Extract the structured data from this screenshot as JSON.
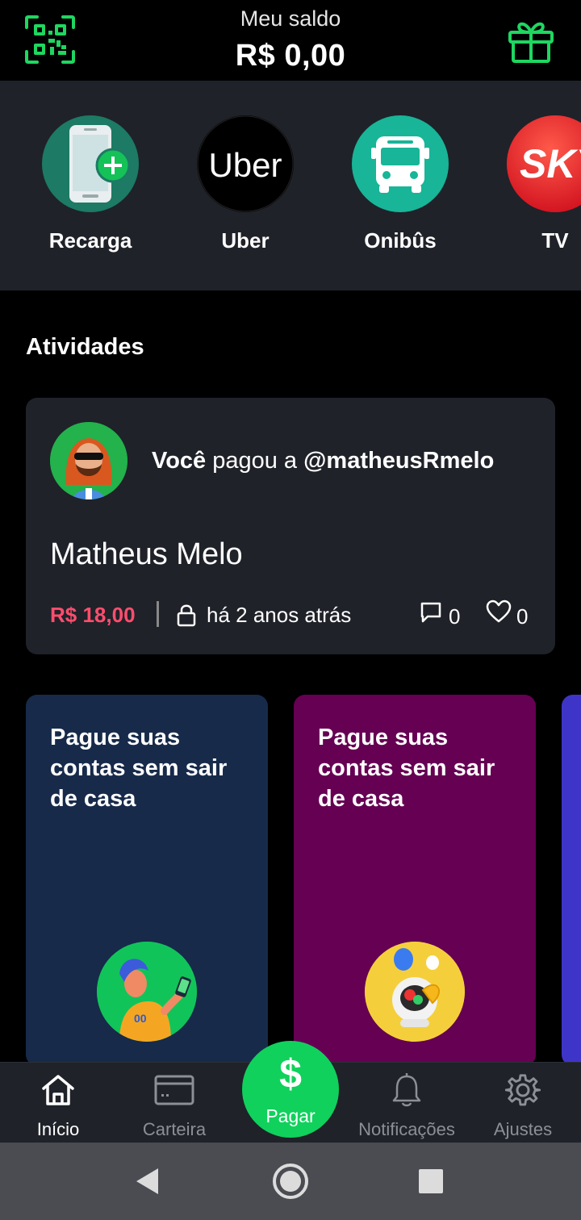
{
  "header": {
    "balance_label": "Meu saldo",
    "balance_value": "R$ 0,00",
    "qr_icon": "qr-code-icon",
    "gift_icon": "gift-icon",
    "accent": "#1ed760"
  },
  "shortcuts": [
    {
      "label": "Recarga",
      "icon": "phone-add-icon",
      "color": "#1d7a64"
    },
    {
      "label": "Uber",
      "icon": "uber-logo",
      "logo_text": "Uber",
      "color": "#000000"
    },
    {
      "label": "Onibûs",
      "icon": "bus-icon",
      "color": "#18b598"
    },
    {
      "label": "TV",
      "icon": "sky-logo",
      "logo_text": "SKY",
      "color": "#e8242a"
    }
  ],
  "activities": {
    "title": "Atividades",
    "item": {
      "actor": "Você",
      "verb": " pagou a ",
      "target": "@matheusRmelo",
      "name": "Matheus Melo",
      "amount": "R$ 18,00",
      "time": "há 2 anos atrás",
      "comments": "0",
      "likes": "0",
      "amount_color": "#ff4d6d"
    }
  },
  "promos": [
    {
      "title": "Pague suas contas sem sair de casa",
      "bg": "#172a4a",
      "art_bg": "#11c45a"
    },
    {
      "title": "Pague suas contas sem sair de casa",
      "bg": "#650052",
      "art_bg": "#f5cf3b"
    }
  ],
  "bottom_nav": {
    "items": [
      {
        "label": "Início",
        "icon": "home-icon",
        "active": true
      },
      {
        "label": "Carteira",
        "icon": "wallet-card-icon",
        "active": false
      },
      {
        "label": "Notificações",
        "icon": "bell-icon",
        "active": false
      },
      {
        "label": "Ajustes",
        "icon": "gear-icon",
        "active": false
      }
    ],
    "pay": {
      "symbol": "$",
      "label": "Pagar",
      "color": "#10d15c"
    }
  },
  "system_nav": {
    "back_icon": "back-triangle-icon",
    "home_icon": "home-circle-icon",
    "recents_icon": "recents-square-icon"
  }
}
